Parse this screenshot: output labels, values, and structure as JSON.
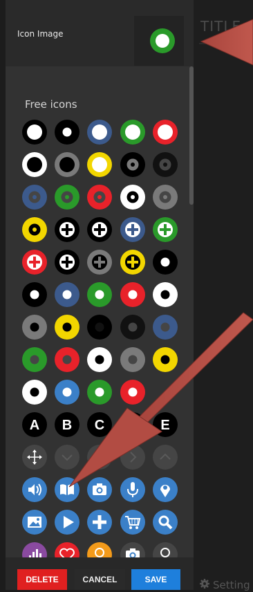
{
  "right_pane": {
    "title": "TITLE:",
    "settings_label": "Setting"
  },
  "icon_image": {
    "label": "Icon Image",
    "preview_icon": "green-ring"
  },
  "free_icons": {
    "label": "Free icons"
  },
  "colors": {
    "black": "#000000",
    "white": "#ffffff",
    "navy": "#3c5a8c",
    "green": "#2a9a2a",
    "red": "#e8222a",
    "yellow": "#f2d600",
    "gray": "#7a7a7a",
    "dark": "#111111",
    "muted": "#454545",
    "blue": "#3b80c8",
    "orange": "#f39a1a",
    "purple": "#8a4aa0"
  },
  "icon_rows": [
    [
      {
        "kind": "ring",
        "bg": "black",
        "ring": "white"
      },
      {
        "kind": "dot",
        "bg": "black",
        "dot": "white"
      },
      {
        "kind": "ring",
        "bg": "navy",
        "ring": "white"
      },
      {
        "kind": "ring",
        "bg": "green",
        "ring": "white"
      },
      {
        "kind": "ring",
        "bg": "red",
        "ring": "white"
      }
    ],
    [
      {
        "kind": "ring",
        "bg": "white",
        "ring": "black"
      },
      {
        "kind": "ring",
        "bg": "gray",
        "ring": "black"
      },
      {
        "kind": "ring",
        "bg": "yellow",
        "ring": "white"
      },
      {
        "kind": "target",
        "bg": "black",
        "inner": "gray"
      },
      {
        "kind": "target",
        "bg": "dark",
        "inner": "muted"
      }
    ],
    [
      {
        "kind": "target",
        "bg": "navy",
        "inner": "muted"
      },
      {
        "kind": "target",
        "bg": "green",
        "inner": "muted"
      },
      {
        "kind": "target",
        "bg": "red",
        "inner": "muted"
      },
      {
        "kind": "target",
        "bg": "white",
        "inner": "black"
      },
      {
        "kind": "target",
        "bg": "gray",
        "inner": "muted"
      }
    ],
    [
      {
        "kind": "target",
        "bg": "yellow",
        "inner": "black"
      },
      {
        "kind": "plus",
        "bg": "black",
        "fg": "white"
      },
      {
        "kind": "plus",
        "bg": "black",
        "fg": "white"
      },
      {
        "kind": "plus",
        "bg": "navy",
        "fg": "white"
      },
      {
        "kind": "plus",
        "bg": "green",
        "fg": "white"
      }
    ],
    [
      {
        "kind": "plus",
        "bg": "red",
        "fg": "white"
      },
      {
        "kind": "plus",
        "bg": "black",
        "fg": "white"
      },
      {
        "kind": "plus",
        "bg": "gray",
        "fg": "black"
      },
      {
        "kind": "plus",
        "bg": "yellow",
        "fg": "black"
      },
      {
        "kind": "dot",
        "bg": "black",
        "dot": "white"
      }
    ],
    [
      {
        "kind": "dot",
        "bg": "black",
        "dot": "white"
      },
      {
        "kind": "dot",
        "bg": "navy",
        "dot": "white"
      },
      {
        "kind": "dot",
        "bg": "green",
        "dot": "white"
      },
      {
        "kind": "dot",
        "bg": "red",
        "dot": "white"
      },
      {
        "kind": "dot",
        "bg": "white",
        "dot": "black"
      }
    ],
    [
      {
        "kind": "dot",
        "bg": "gray",
        "dot": "black"
      },
      {
        "kind": "dot",
        "bg": "yellow",
        "dot": "black"
      },
      {
        "kind": "dot",
        "bg": "black",
        "dot": "dark"
      },
      {
        "kind": "dot",
        "bg": "dark",
        "dot": "muted"
      },
      {
        "kind": "dot",
        "bg": "navy",
        "dot": "muted"
      }
    ],
    [
      {
        "kind": "dot",
        "bg": "green",
        "dot": "muted"
      },
      {
        "kind": "dot",
        "bg": "red",
        "dot": "muted"
      },
      {
        "kind": "dot",
        "bg": "white",
        "dot": "black"
      },
      {
        "kind": "dot",
        "bg": "gray",
        "dot": "muted"
      },
      {
        "kind": "dot",
        "bg": "yellow",
        "dot": "black"
      }
    ],
    [
      {
        "kind": "dot",
        "bg": "white",
        "dot": "black"
      },
      {
        "kind": "dot",
        "bg": "blue",
        "dot": "white"
      },
      {
        "kind": "dot",
        "bg": "green",
        "dot": "white"
      },
      {
        "kind": "dot",
        "bg": "red",
        "dot": "white"
      },
      {
        "kind": "none"
      }
    ],
    [
      {
        "kind": "letter",
        "bg": "black",
        "text": "A"
      },
      {
        "kind": "letter",
        "bg": "black",
        "text": "B"
      },
      {
        "kind": "letter",
        "bg": "black",
        "text": "C"
      },
      {
        "kind": "letter",
        "bg": "black",
        "text": "D"
      },
      {
        "kind": "letter",
        "bg": "black",
        "text": "E"
      }
    ],
    [
      {
        "kind": "glyph",
        "bg": "muted",
        "glyph": "move"
      },
      {
        "kind": "glyph",
        "bg": "muted",
        "glyph": "chev-down"
      },
      {
        "kind": "glyph",
        "bg": "muted",
        "glyph": "chev-left"
      },
      {
        "kind": "glyph",
        "bg": "muted",
        "glyph": "chev-right"
      },
      {
        "kind": "glyph",
        "bg": "muted",
        "glyph": "chev-up"
      }
    ],
    [
      {
        "kind": "glyph",
        "bg": "blue",
        "glyph": "speaker"
      },
      {
        "kind": "glyph",
        "bg": "blue",
        "glyph": "book"
      },
      {
        "kind": "glyph",
        "bg": "blue",
        "glyph": "camera"
      },
      {
        "kind": "glyph",
        "bg": "blue",
        "glyph": "mic"
      },
      {
        "kind": "glyph",
        "bg": "blue",
        "glyph": "pin"
      }
    ],
    [
      {
        "kind": "glyph",
        "bg": "blue",
        "glyph": "image"
      },
      {
        "kind": "glyph",
        "bg": "blue",
        "glyph": "play"
      },
      {
        "kind": "glyph",
        "bg": "blue",
        "glyph": "plus"
      },
      {
        "kind": "glyph",
        "bg": "blue",
        "glyph": "cart"
      },
      {
        "kind": "glyph",
        "bg": "blue",
        "glyph": "search"
      }
    ],
    [
      {
        "kind": "glyph",
        "bg": "purple",
        "glyph": "chart"
      },
      {
        "kind": "glyph",
        "bg": "red",
        "glyph": "heart"
      },
      {
        "kind": "glyph",
        "bg": "orange",
        "glyph": "bulb"
      },
      {
        "kind": "glyph",
        "bg": "muted",
        "glyph": "camera"
      },
      {
        "kind": "glyph",
        "bg": "muted",
        "glyph": "bulb"
      }
    ]
  ],
  "buttons": {
    "delete": "DELETE",
    "cancel": "CANCEL",
    "save": "SAVE"
  }
}
